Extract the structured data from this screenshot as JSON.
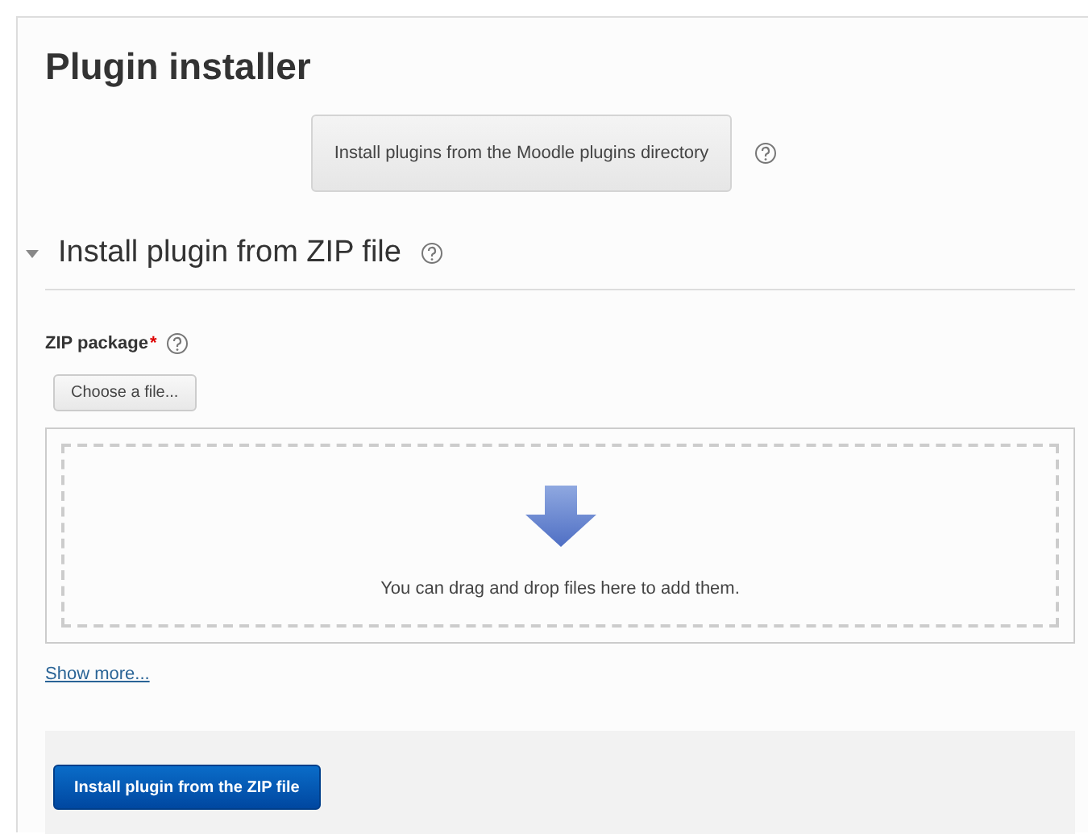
{
  "page": {
    "title": "Plugin installer"
  },
  "directory_button": {
    "label": "Install plugins from the Moodle plugins directory"
  },
  "section": {
    "title": "Install plugin from ZIP file",
    "expanded": true,
    "field": {
      "label": "ZIP package",
      "required_mark": "*",
      "choose_button": "Choose a file...",
      "dropzone_text": "You can drag and drop files here to add them."
    },
    "show_more": "Show more..."
  },
  "submit_button": {
    "label": "Install plugin from the ZIP file"
  }
}
